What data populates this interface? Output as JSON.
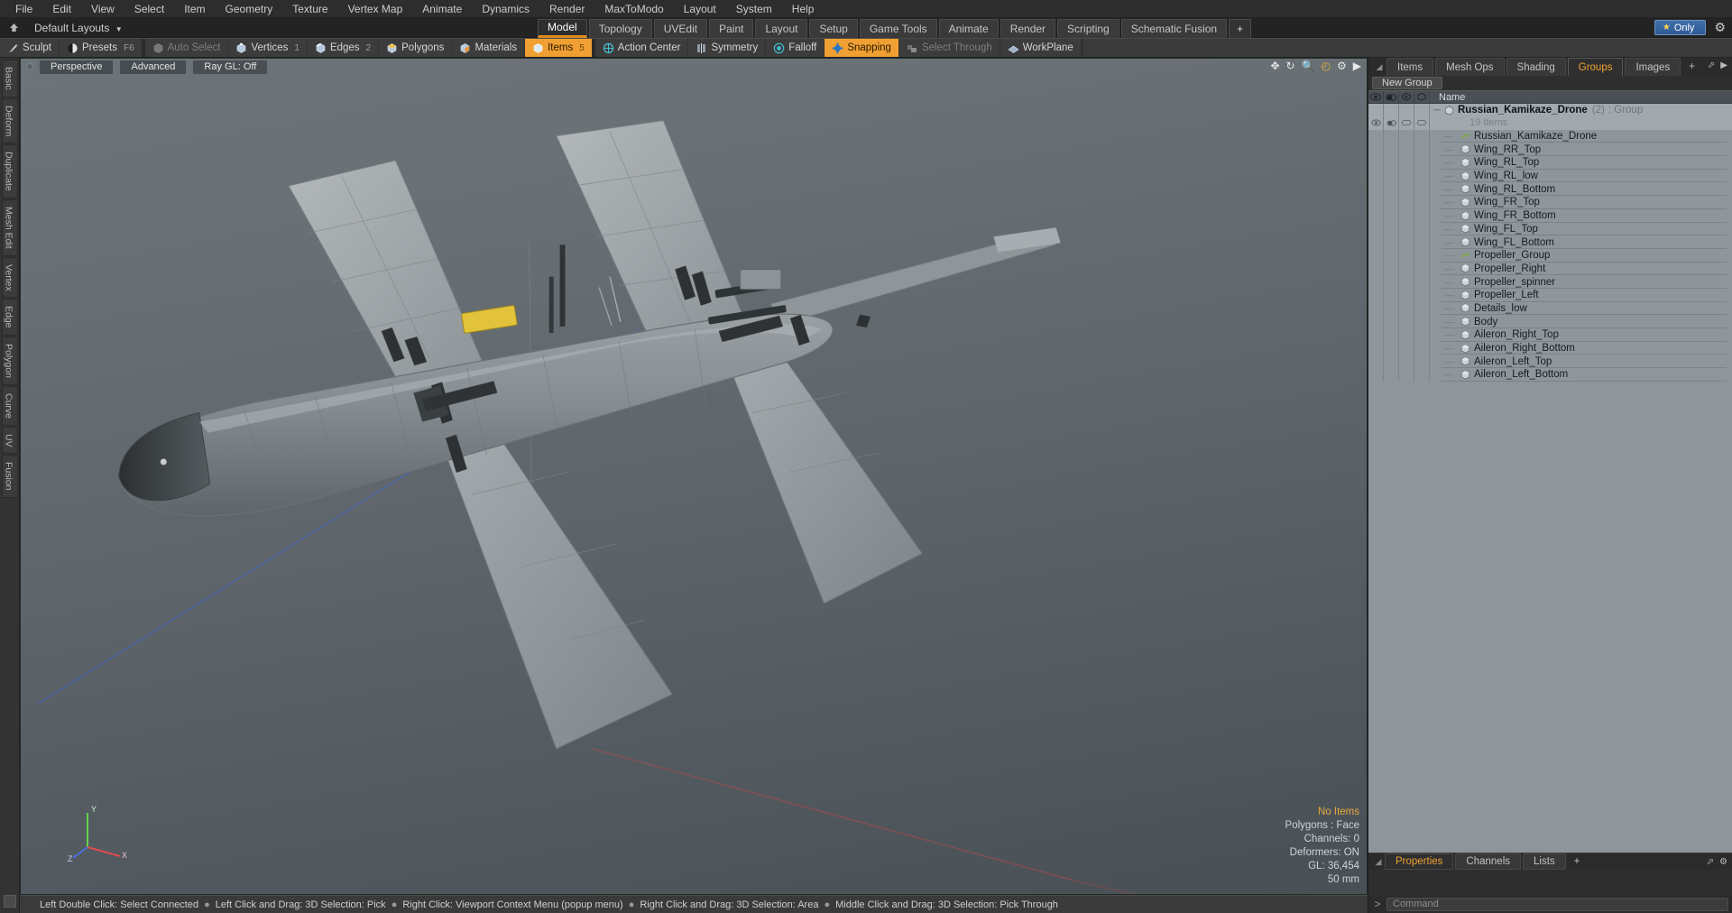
{
  "menubar": {
    "items": [
      "File",
      "Edit",
      "View",
      "Select",
      "Item",
      "Geometry",
      "Texture",
      "Vertex Map",
      "Animate",
      "Dynamics",
      "Render",
      "MaxToModo",
      "Layout",
      "System",
      "Help"
    ]
  },
  "layoutbar": {
    "home_icon": "home-up-icon",
    "dropdown_label": "Default Layouts",
    "tabs": [
      {
        "label": "Model",
        "active": true
      },
      {
        "label": "Topology",
        "active": false
      },
      {
        "label": "UVEdit",
        "active": false
      },
      {
        "label": "Paint",
        "active": false
      },
      {
        "label": "Layout",
        "active": false
      },
      {
        "label": "Setup",
        "active": false
      },
      {
        "label": "Game Tools",
        "active": false
      },
      {
        "label": "Animate",
        "active": false
      },
      {
        "label": "Render",
        "active": false
      },
      {
        "label": "Scripting",
        "active": false
      },
      {
        "label": "Schematic Fusion",
        "active": false
      },
      {
        "label": "+",
        "active": false
      }
    ],
    "only_button": "Only",
    "only_star": "★",
    "gear_icon": "gear-icon"
  },
  "toolbar": {
    "groups": [
      {
        "items": [
          {
            "label": "Sculpt",
            "icon": "brush-icon",
            "state": "normal",
            "badge": ""
          },
          {
            "label": "Presets",
            "icon": "sphere-icon",
            "state": "normal",
            "badge": "F6"
          }
        ]
      },
      {
        "items": [
          {
            "label": "Auto Select",
            "icon": "cube-grey-icon",
            "state": "dim",
            "badge": ""
          },
          {
            "label": "Vertices",
            "icon": "cube-vertex-icon",
            "state": "normal",
            "badge": "1"
          },
          {
            "label": "Edges",
            "icon": "cube-edge-icon",
            "state": "normal",
            "badge": "2"
          },
          {
            "label": "Polygons",
            "icon": "cube-poly-icon",
            "state": "normal",
            "badge": ""
          },
          {
            "label": "Materials",
            "icon": "cube-material-icon",
            "state": "normal",
            "badge": ""
          },
          {
            "label": "Items",
            "icon": "cube-item-icon",
            "state": "active",
            "badge": "5"
          }
        ]
      },
      {
        "items": [
          {
            "label": "Action Center",
            "icon": "crosshair-icon",
            "state": "normal",
            "badge": ""
          },
          {
            "label": "Symmetry",
            "icon": "symmetry-icon",
            "state": "normal",
            "badge": ""
          },
          {
            "label": "Falloff",
            "icon": "falloff-icon",
            "state": "normal",
            "badge": ""
          },
          {
            "label": "Snapping",
            "icon": "snap-icon",
            "state": "active",
            "badge": ""
          },
          {
            "label": "Select Through",
            "icon": "select-through-icon",
            "state": "dim",
            "badge": ""
          },
          {
            "label": "WorkPlane",
            "icon": "workplane-icon",
            "state": "normal",
            "badge": ""
          }
        ]
      }
    ]
  },
  "leftrail": {
    "tabs": [
      "Basic",
      "Deform",
      "Duplicate",
      "Mesh Edit",
      "Vertex",
      "Edge",
      "Polygon",
      "Curve",
      "UV",
      "Fusion"
    ]
  },
  "viewport": {
    "perspective_label": "Perspective",
    "advanced_label": "Advanced",
    "raygl_label": "Ray GL: Off",
    "corner_icons": [
      "move-icon",
      "rotate-icon",
      "zoom-icon",
      "fit-icon",
      "gear-icon",
      "play-icon"
    ],
    "axis_labels": {
      "y": "Y",
      "x": "X",
      "z": "Z"
    },
    "stats": {
      "selection": "No Items",
      "polygons": "Polygons : Face",
      "channels": "Channels: 0",
      "deformers": "Deformers: ON",
      "gl": "GL: 36,454",
      "scale": "50 mm"
    }
  },
  "hintbar": {
    "hints": [
      "Left Double Click: Select Connected",
      "Left Click and Drag: 3D Selection: Pick",
      "Right Click: Viewport Context Menu (popup menu)",
      "Right Click and Drag: 3D Selection: Area",
      "Middle Click and Drag: 3D Selection: Pick Through"
    ],
    "separator": "●"
  },
  "rightpanel": {
    "tabs": [
      {
        "label": "Items",
        "active": false
      },
      {
        "label": "Mesh Ops",
        "active": false
      },
      {
        "label": "Shading",
        "active": false
      },
      {
        "label": "Groups",
        "active": true
      },
      {
        "label": "Images",
        "active": false
      },
      {
        "label": "+",
        "active": false
      }
    ],
    "new_group_button": "New Group",
    "list_header": {
      "columns": [
        "eye-icon",
        "render-icon",
        "lock-icon",
        "shade-icon"
      ],
      "name_label": "Name"
    },
    "group": {
      "name": "Russian_Kamikaze_Drone",
      "count": "(2)",
      "type": ": Group",
      "item_count_label": "19 Items"
    },
    "items": [
      {
        "name": "Russian_Kamikaze_Drone",
        "icon": "locator-icon"
      },
      {
        "name": "Wing_RR_Top",
        "icon": "mesh-icon"
      },
      {
        "name": "Wing_RL_Top",
        "icon": "mesh-icon"
      },
      {
        "name": "Wing_RL_low",
        "icon": "mesh-icon"
      },
      {
        "name": "Wing_RL_Bottom",
        "icon": "mesh-icon"
      },
      {
        "name": "Wing_FR_Top",
        "icon": "mesh-icon"
      },
      {
        "name": "Wing_FR_Bottom",
        "icon": "mesh-icon"
      },
      {
        "name": "Wing_FL_Top",
        "icon": "mesh-icon"
      },
      {
        "name": "Wing_FL_Bottom",
        "icon": "mesh-icon"
      },
      {
        "name": "Propeller_Group",
        "icon": "locator-icon"
      },
      {
        "name": "Propeller_Right",
        "icon": "mesh-icon"
      },
      {
        "name": "Propeller_spinner",
        "icon": "mesh-icon"
      },
      {
        "name": "Propeller_Left",
        "icon": "mesh-icon"
      },
      {
        "name": "Details_low",
        "icon": "mesh-icon"
      },
      {
        "name": "Body",
        "icon": "mesh-icon"
      },
      {
        "name": "Aileron_Right_Top",
        "icon": "mesh-icon"
      },
      {
        "name": "Aileron_Right_Bottom",
        "icon": "mesh-icon"
      },
      {
        "name": "Aileron_Left_Top",
        "icon": "mesh-icon"
      },
      {
        "name": "Aileron_Left_Bottom",
        "icon": "mesh-icon"
      }
    ],
    "bottom_tabs": [
      {
        "label": "Properties",
        "active": true
      },
      {
        "label": "Channels",
        "active": false
      },
      {
        "label": "Lists",
        "active": false
      },
      {
        "label": "+",
        "active": false
      }
    ]
  },
  "command": {
    "prompt": ">",
    "placeholder": "Command"
  },
  "colors": {
    "accent_orange": "#f0a033",
    "viewport_bg": "#5f666c",
    "panel_bg": "#2e2e2e",
    "tree_bg": "#8e969c"
  }
}
